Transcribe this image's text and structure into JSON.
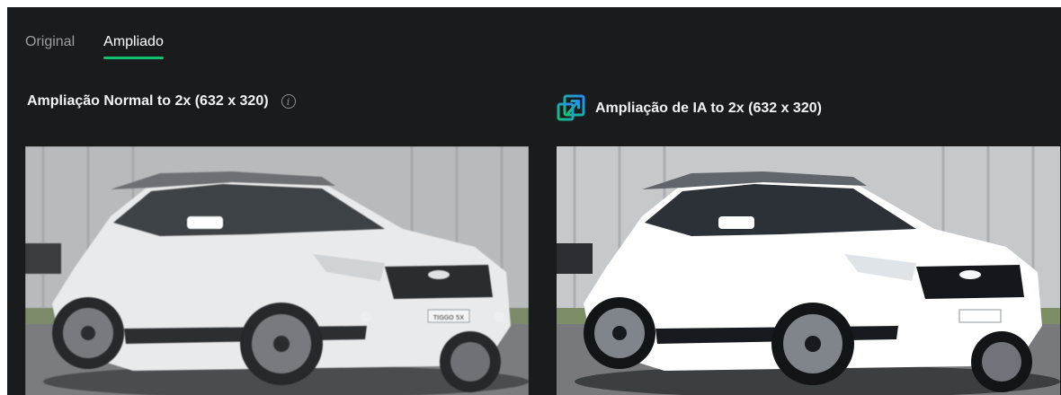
{
  "tabs": [
    {
      "label": "Original",
      "active": false
    },
    {
      "label": "Ampliado",
      "active": true
    }
  ],
  "panels": {
    "normal": {
      "title": "Ampliação Normal to 2x (632 x 320)",
      "icon": "info-icon"
    },
    "ai": {
      "title": "Ampliação de IA to 2x (632 x 320)",
      "icon": "ai-upscale-icon"
    }
  },
  "car_badge": "TIGGO 5X",
  "colors": {
    "background": "#1a1b1d",
    "accent": "#12c16f",
    "text": "#f2f2f2",
    "muted": "#9b9ea3"
  }
}
